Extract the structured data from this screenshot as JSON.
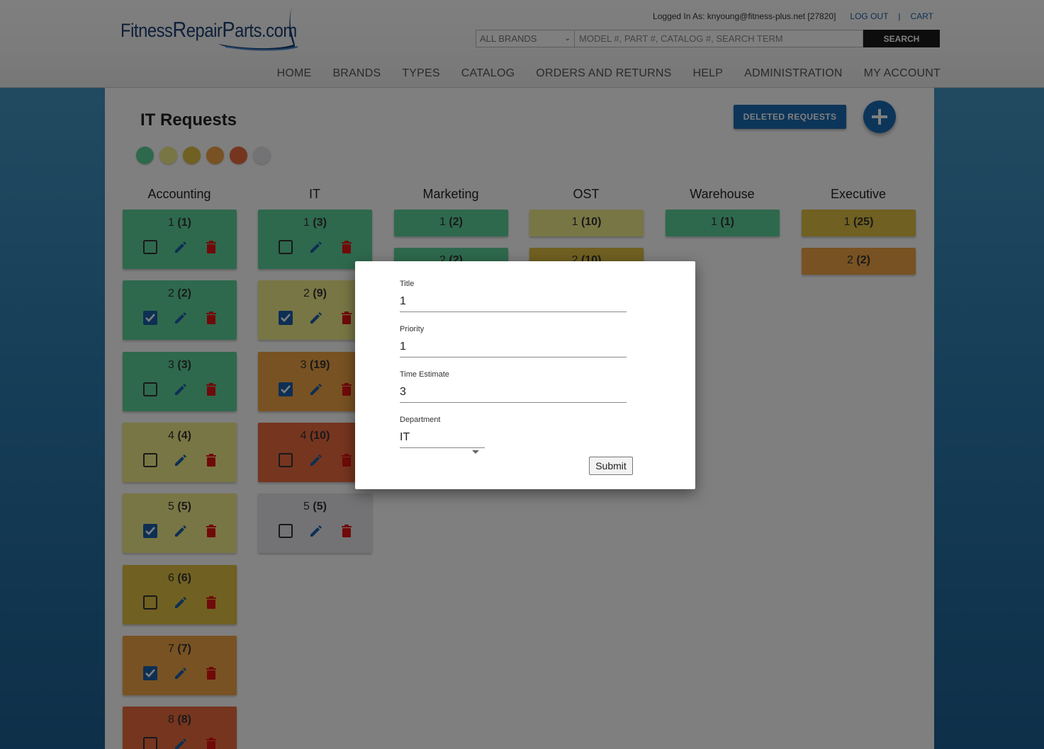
{
  "header": {
    "logo": {
      "part1": "Fitness",
      "part2": "R",
      "part3": "epair",
      "part4": "P",
      "part5": "arts.com"
    },
    "logged_in": "Logged In As: knyoung@fitness-plus.net [27820]",
    "logout": "LOG OUT",
    "separator": "|",
    "cart": "CART",
    "brand_select": "ALL BRANDS",
    "search_placeholder": "MODEL #, PART #, CATALOG #, SEARCH TERM",
    "search_button": "SEARCH",
    "nav": [
      "HOME",
      "BRANDS",
      "TYPES",
      "CATALOG",
      "ORDERS AND RETURNS",
      "HELP",
      "ADMINISTRATION",
      "MY ACCOUNT"
    ]
  },
  "page": {
    "title": "IT Requests",
    "deleted_button": "DELETED REQUESTS",
    "add_icon": "plus-icon",
    "legend_colors": [
      "#5dd39a",
      "#f2ec8a",
      "#e0c042",
      "#f0a444",
      "#ec6a3e",
      "#e6e6ea"
    ]
  },
  "colors": {
    "green": "#5dd39a",
    "yellow": "#f2ec8a",
    "gold": "#e0c042",
    "orange": "#f0a444",
    "red": "#ec6a3e",
    "grey": "#e6e6ea",
    "accent": "#1b6ab4",
    "delete": "#e01515"
  },
  "columns": [
    {
      "name": "Accounting",
      "cards": [
        {
          "title": "1",
          "priority": "(1)",
          "color": "green",
          "checked": false
        },
        {
          "title": "2",
          "priority": "(2)",
          "color": "green",
          "checked": true
        },
        {
          "title": "3",
          "priority": "(3)",
          "color": "green",
          "checked": false
        },
        {
          "title": "4",
          "priority": "(4)",
          "color": "yellow",
          "checked": false
        },
        {
          "title": "5",
          "priority": "(5)",
          "color": "yellow",
          "checked": true
        },
        {
          "title": "6",
          "priority": "(6)",
          "color": "gold",
          "checked": false
        },
        {
          "title": "7",
          "priority": "(7)",
          "color": "orange",
          "checked": true
        },
        {
          "title": "8",
          "priority": "(8)",
          "color": "red",
          "checked": false
        }
      ]
    },
    {
      "name": "IT",
      "cards": [
        {
          "title": "1",
          "priority": "(3)",
          "color": "green",
          "checked": false
        },
        {
          "title": "2",
          "priority": "(9)",
          "color": "yellow",
          "checked": true
        },
        {
          "title": "3",
          "priority": "(19)",
          "color": "orange",
          "checked": true
        },
        {
          "title": "4",
          "priority": "(10)",
          "color": "red",
          "checked": false
        },
        {
          "title": "5",
          "priority": "(5)",
          "color": "grey",
          "checked": false
        }
      ]
    },
    {
      "name": "Marketing",
      "cards": [
        {
          "title": "1",
          "priority": "(2)",
          "color": "green"
        },
        {
          "title": "2",
          "priority": "(2)",
          "color": "green"
        }
      ]
    },
    {
      "name": "OST",
      "cards": [
        {
          "title": "1",
          "priority": "(10)",
          "color": "yellow"
        },
        {
          "title": "2",
          "priority": "(10)",
          "color": "gold"
        }
      ]
    },
    {
      "name": "Warehouse",
      "cards": [
        {
          "title": "1",
          "priority": "(1)",
          "color": "green"
        }
      ]
    },
    {
      "name": "Executive",
      "cards": [
        {
          "title": "1",
          "priority": "(25)",
          "color": "gold"
        },
        {
          "title": "2",
          "priority": "(2)",
          "color": "orange"
        }
      ]
    }
  ],
  "modal": {
    "title_label": "Title",
    "title_value": "1",
    "priority_label": "Priority",
    "priority_value": "1",
    "time_label": "Time Estimate",
    "time_value": "3",
    "dept_label": "Department",
    "dept_value": "IT",
    "submit": "Submit"
  }
}
